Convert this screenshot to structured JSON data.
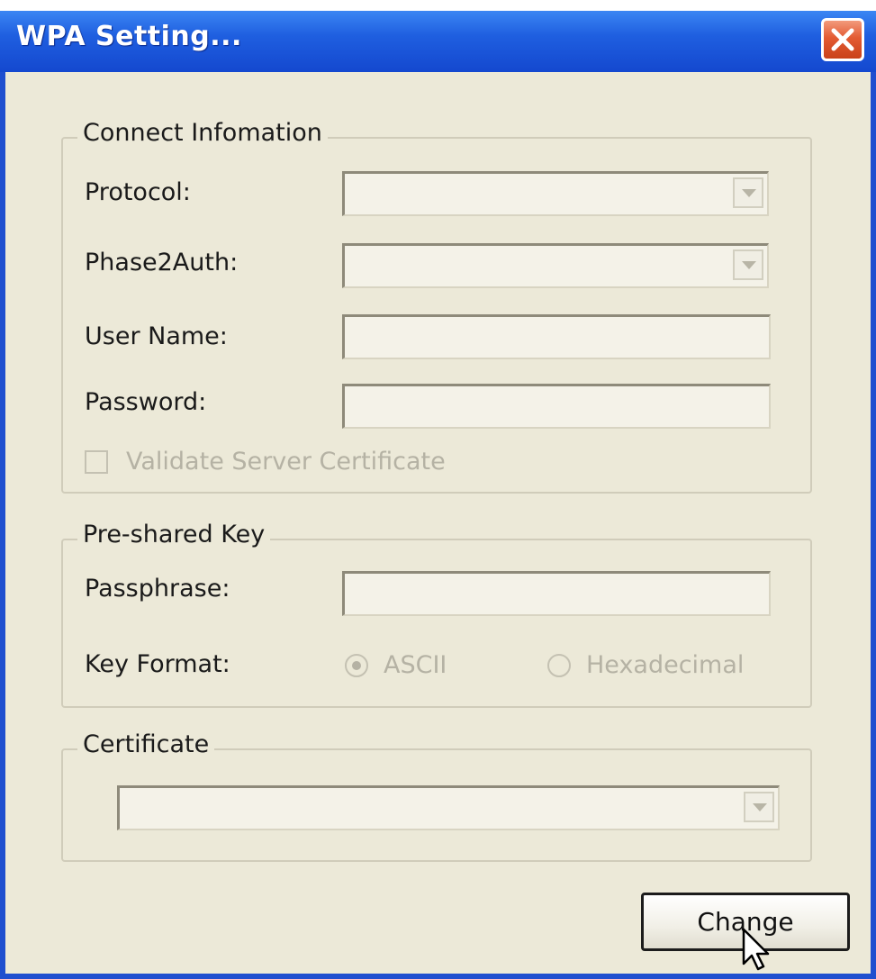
{
  "window": {
    "title": "WPA Setting...",
    "close_icon": "close-icon",
    "accent_color": "#1f5fe0",
    "close_color": "#e35b33"
  },
  "connect_group": {
    "title": "Connect Infomation",
    "protocol_label": "Protocol:",
    "protocol_value": "",
    "phase2_label": "Phase2Auth:",
    "phase2_value": "",
    "username_label": "User Name:",
    "username_value": "",
    "password_label": "Password:",
    "password_value": "",
    "validate_label": "Validate Server Certificate",
    "validate_checked": false
  },
  "psk_group": {
    "title": "Pre-shared Key",
    "passphrase_label": "Passphrase:",
    "passphrase_value": "",
    "key_format_label": "Key Format:",
    "options": [
      "ASCII",
      "Hexadecimal"
    ],
    "selected_option": "ASCII"
  },
  "cert_group": {
    "title": "Certificate",
    "value": ""
  },
  "buttons": {
    "change_label": "Change"
  }
}
